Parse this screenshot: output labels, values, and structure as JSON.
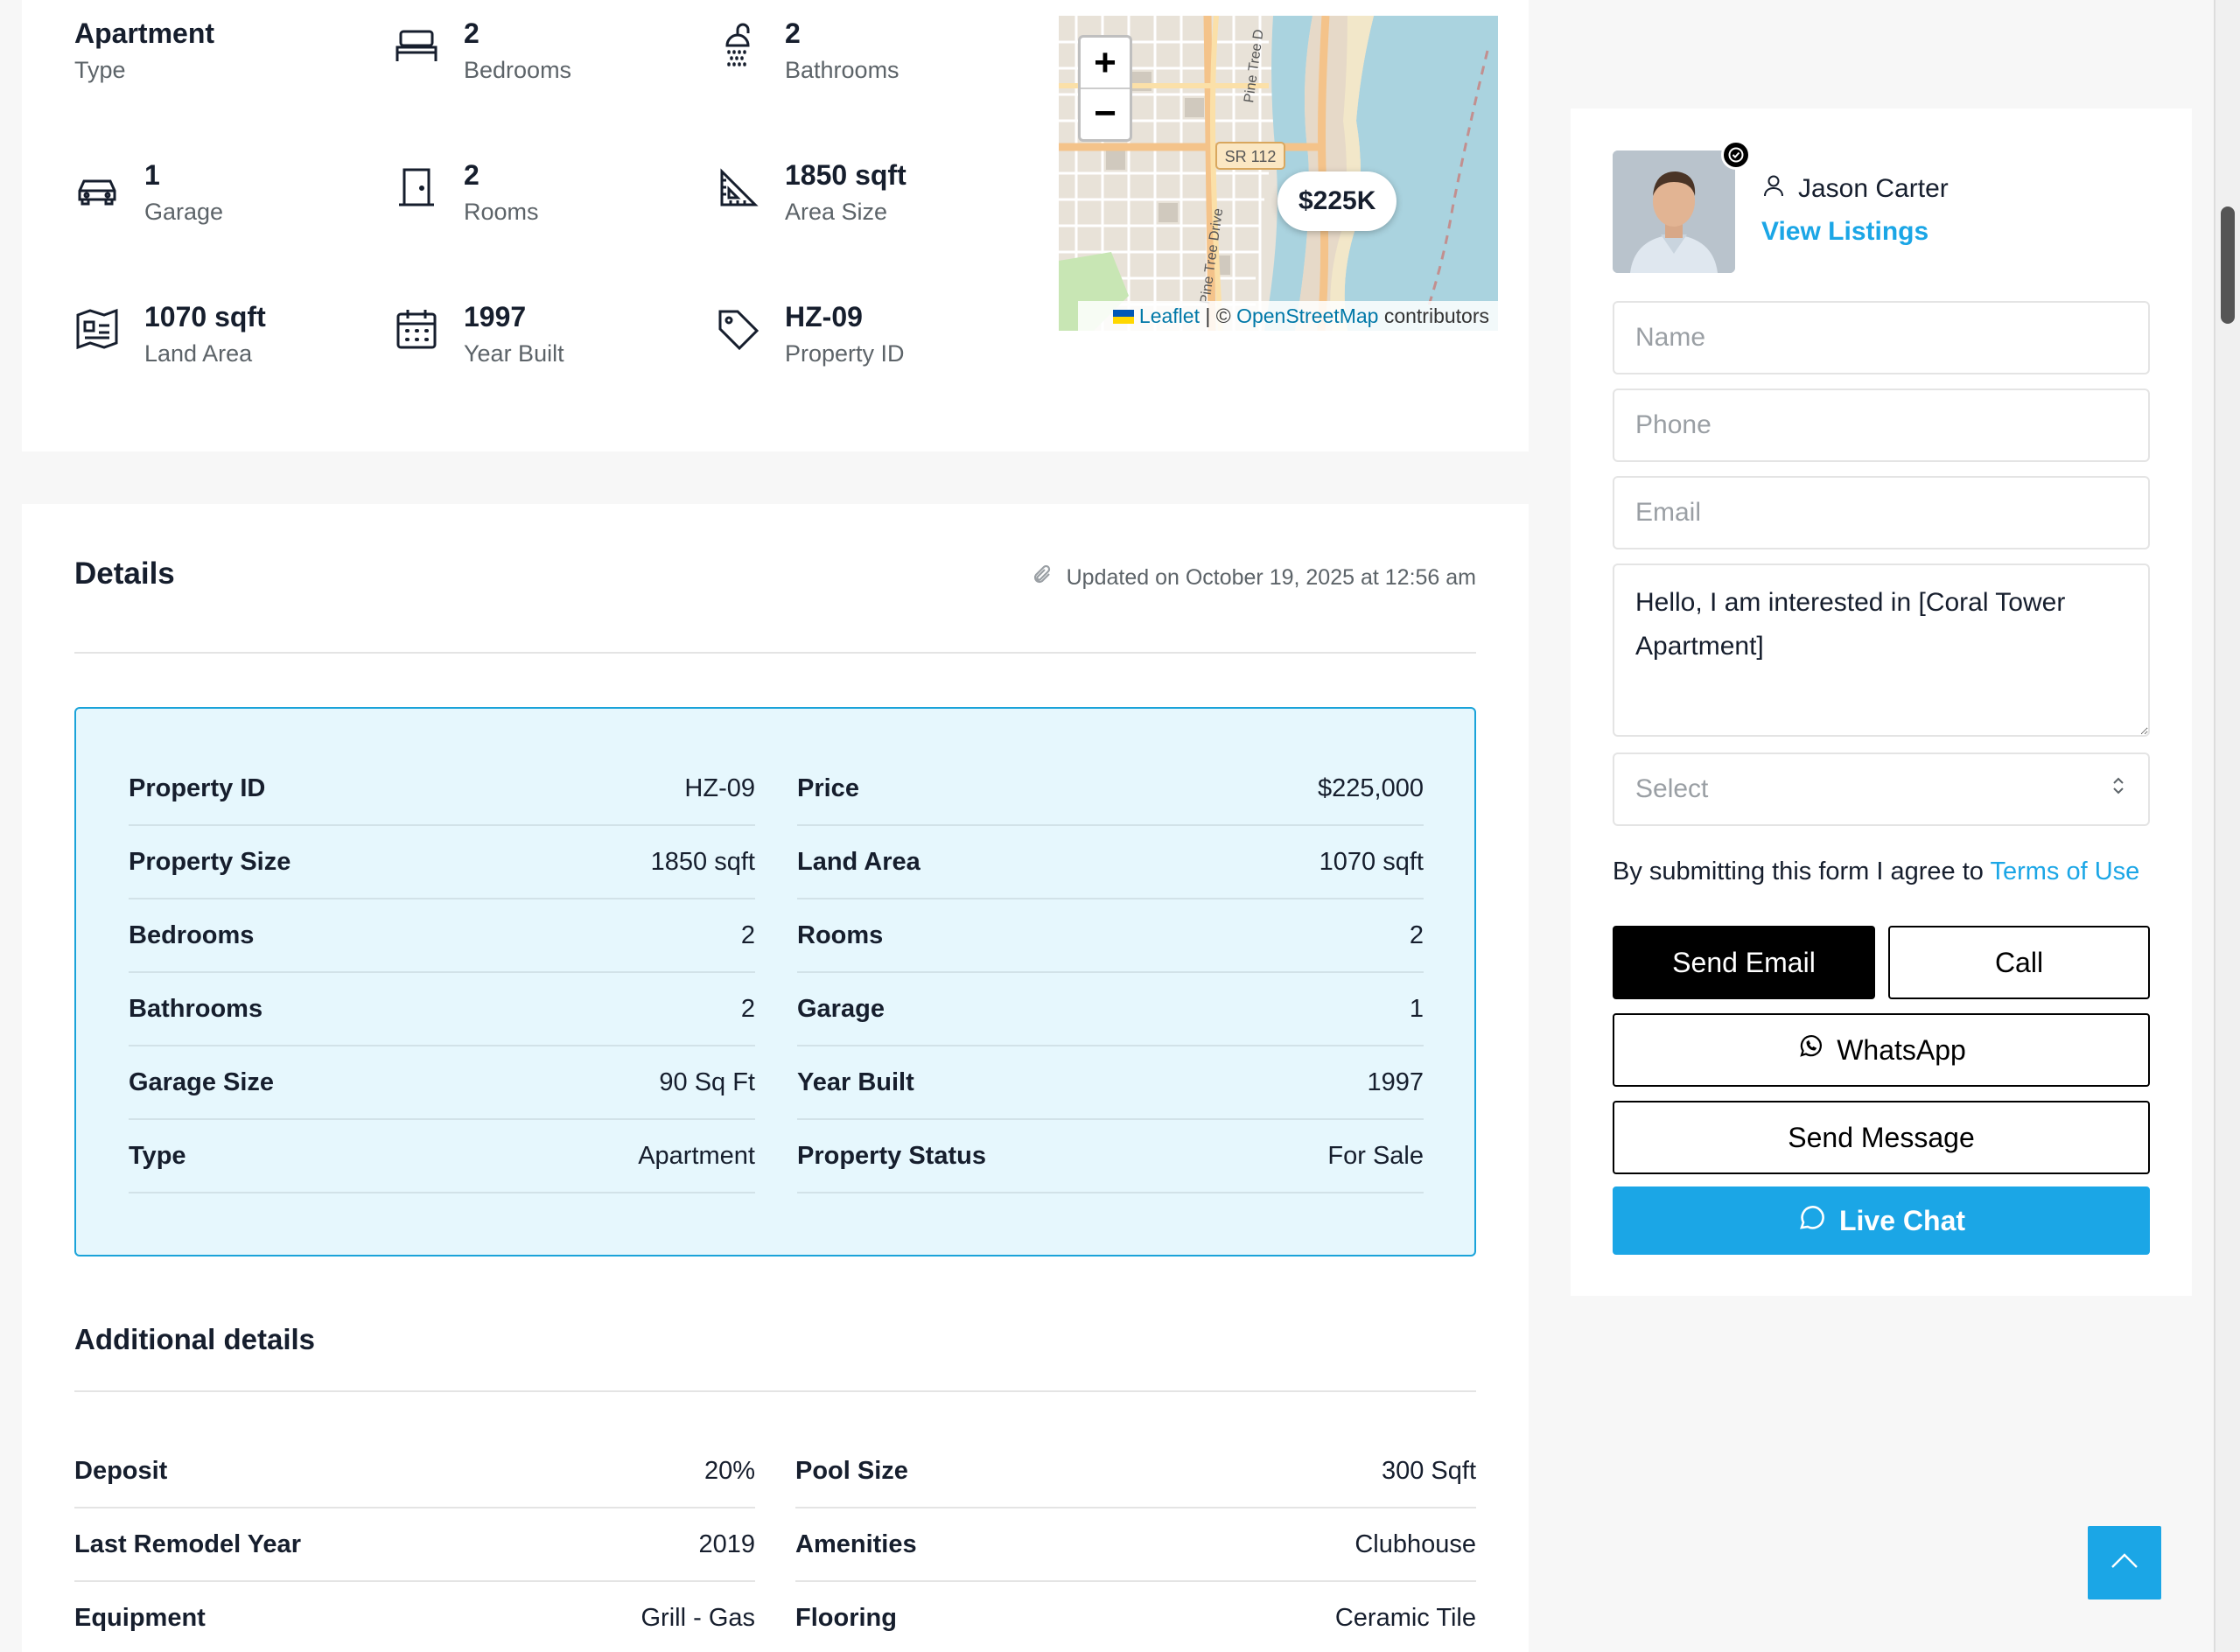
{
  "overview": {
    "items": [
      {
        "value": "Apartment",
        "label": "Type",
        "icon": "none"
      },
      {
        "value": "2",
        "label": "Bedrooms",
        "icon": "bed-icon"
      },
      {
        "value": "2",
        "label": "Bathrooms",
        "icon": "shower-icon"
      },
      {
        "value": "1",
        "label": "Garage",
        "icon": "car-icon"
      },
      {
        "value": "2",
        "label": "Rooms",
        "icon": "door-icon"
      },
      {
        "value": "1850 sqft",
        "label": "Area Size",
        "icon": "ruler-triangle-icon"
      },
      {
        "value": "1070 sqft",
        "label": "Land Area",
        "icon": "land-map-icon"
      },
      {
        "value": "1997",
        "label": "Year Built",
        "icon": "calendar-icon"
      },
      {
        "value": "HZ-09",
        "label": "Property ID",
        "icon": "tag-icon"
      }
    ]
  },
  "map": {
    "zoom_in": "+",
    "zoom_out": "−",
    "price_pin": "$225K",
    "road_labels": [
      "SR 112",
      "Pine Tree Drive",
      "Pine Tree D"
    ],
    "attribution_leaflet": "Leaflet",
    "attribution_sep": "| ©",
    "attribution_osm": "OpenStreetMap",
    "attribution_tail": "contributors"
  },
  "details": {
    "title": "Details",
    "updated": "Updated on October 19, 2025 at 12:56 am",
    "left_rows": [
      {
        "key": "Property ID",
        "value": "HZ-09"
      },
      {
        "key": "Property Size",
        "value": "1850 sqft"
      },
      {
        "key": "Bedrooms",
        "value": "2"
      },
      {
        "key": "Bathrooms",
        "value": "2"
      },
      {
        "key": "Garage Size",
        "value": "90 Sq Ft"
      },
      {
        "key": "Type",
        "value": "Apartment"
      }
    ],
    "right_rows": [
      {
        "key": "Price",
        "value": "$225,000"
      },
      {
        "key": "Land Area",
        "value": "1070 sqft"
      },
      {
        "key": "Rooms",
        "value": "2"
      },
      {
        "key": "Garage",
        "value": "1"
      },
      {
        "key": "Year Built",
        "value": "1997"
      },
      {
        "key": "Property Status",
        "value": "For Sale"
      }
    ]
  },
  "additional": {
    "title": "Additional details",
    "left_rows": [
      {
        "key": "Deposit",
        "value": "20%"
      },
      {
        "key": "Last Remodel Year",
        "value": "2019"
      },
      {
        "key": "Equipment",
        "value": "Grill - Gas"
      }
    ],
    "right_rows": [
      {
        "key": "Pool Size",
        "value": "300 Sqft"
      },
      {
        "key": "Amenities",
        "value": "Clubhouse"
      },
      {
        "key": "Flooring",
        "value": "Ceramic Tile"
      }
    ]
  },
  "contact": {
    "agent_name": "Jason Carter",
    "view_listings": "View Listings",
    "name_placeholder": "Name",
    "phone_placeholder": "Phone",
    "email_placeholder": "Email",
    "message_value": "Hello, I am interested in [Coral Tower Apartment]",
    "select_value": "Select",
    "terms_prefix": "By submitting this form I agree to",
    "terms_link": "Terms of Use",
    "send_email": "Send Email",
    "call": "Call",
    "whatsapp": "WhatsApp",
    "send_message": "Send Message",
    "live_chat": "Live Chat"
  },
  "colors": {
    "accent": "#1ba6e6",
    "details_bg": "#e6f7fd",
    "details_border": "#1aa3d9"
  }
}
